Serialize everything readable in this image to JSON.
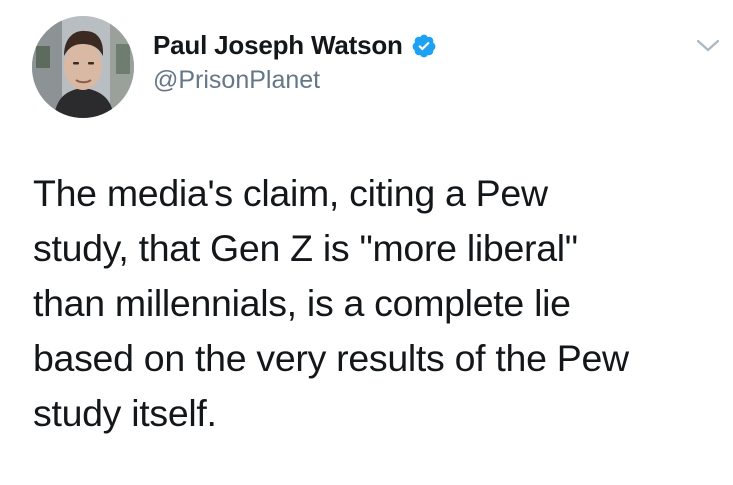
{
  "author": {
    "display_name": "Paul Joseph Watson",
    "handle": "@PrisonPlanet",
    "verified": true,
    "verified_icon": "verified-badge-icon"
  },
  "menu": {
    "icon": "chevron-down-icon"
  },
  "tweet": {
    "lines": [
      "The media's claim, citing a Pew",
      "study, that Gen Z is \"more liberal\"",
      "than millennials, is a complete lie",
      "based on the very results of the Pew",
      "study itself."
    ]
  },
  "colors": {
    "text": "#14171a",
    "muted": "#657786",
    "verified_blue": "#1da1f2",
    "chevron": "#aab8c2"
  }
}
